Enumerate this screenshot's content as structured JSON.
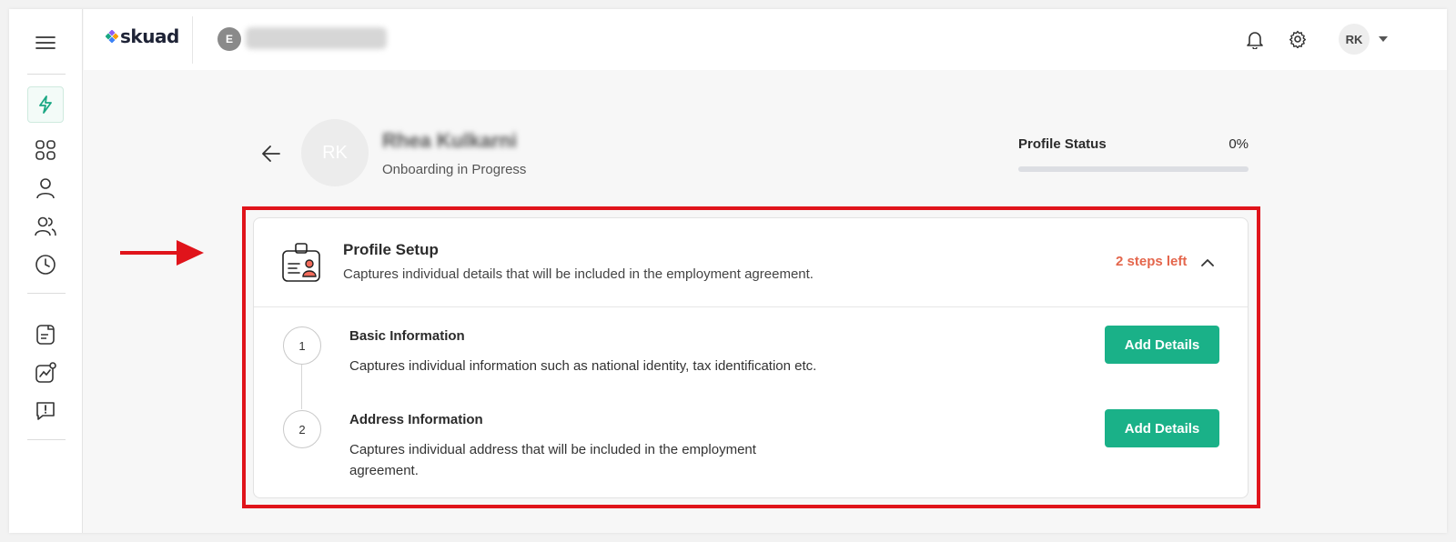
{
  "brand": {
    "logo_text": "skuad"
  },
  "header": {
    "entity_initial": "E",
    "user_initials": "RK"
  },
  "sidebar": {
    "items": [
      {
        "icon": "menu-icon"
      },
      {
        "icon": "bolt-icon",
        "active": true
      },
      {
        "icon": "grid-icon"
      },
      {
        "icon": "person-icon"
      },
      {
        "icon": "people-icon"
      },
      {
        "icon": "clock-icon"
      },
      {
        "icon": "document-icon"
      },
      {
        "icon": "chart-icon"
      },
      {
        "icon": "feedback-icon"
      }
    ]
  },
  "profile": {
    "initials": "RK",
    "name": "Rhea Kulkarni",
    "status_text": "Onboarding in Progress",
    "profile_status_label": "Profile Status",
    "profile_status_value": "0%",
    "progress_fraction": 0
  },
  "card": {
    "title": "Profile Setup",
    "description": "Captures individual details that will be included in the employment agreement.",
    "steps_left": "2 steps left",
    "steps": [
      {
        "number": "1",
        "title": "Basic Information",
        "description": "Captures individual information such as national identity, tax identification etc.",
        "button_label": "Add Details"
      },
      {
        "number": "2",
        "title": "Address Information",
        "description": "Captures individual address that will be included in the employment agreement.",
        "button_label": "Add Details"
      }
    ]
  },
  "colors": {
    "accent": "#1ab188",
    "highlight": "#e0141b",
    "steps_left": "#e4664c"
  }
}
